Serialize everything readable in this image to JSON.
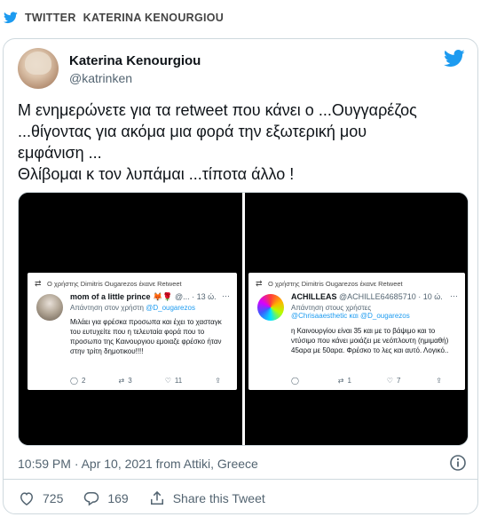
{
  "source": {
    "platform": "TWITTER",
    "author": "KATERINA KENOURGIOU"
  },
  "tweet": {
    "name": "Katerina Kenourgiou",
    "handle": "@katrinken",
    "text_lines": [
      "Μ ενημερώνετε για τα retweet που κάνει ο ...Ουγγαρέζος",
      "...θίγοντας για ακόμα μια φορά την εξωτερική μου",
      "εμφάνιση ...",
      "Θλίβομαι κ τον λυπάμαι ...τίποτα άλλο !"
    ],
    "timestamp": "10:59 PM · Apr 10, 2021 from Attiki, Greece",
    "likes": "725",
    "replies": "169",
    "share_label": "Share this Tweet"
  },
  "media": {
    "left": {
      "retweet_line": "Ο χρήστης Dimitris Ougarezos έκανε Retweet",
      "name": "mom of a little prince",
      "name_emoji": "🦊🌹",
      "meta": "@... · 13 ώ.",
      "reply_prefix": "Απάντηση στον χρήστη",
      "reply_mentions": "@D_ougarezos",
      "body": "Μιλάει για φρέσκα προσωπα και έχει το χασταγκ του ευτυχείτε που η τελευταία φορά που το προσωπο της Καινουργιου εμοιαζε φρέσκο ήταν στην τρίτη δημοτικου!!!!",
      "reply_count": "2",
      "retweet_count": "3",
      "like_count": "11"
    },
    "right": {
      "retweet_line": "Ο χρήστης Dimitris Ougarezos έκανε Retweet",
      "name": "ACHILLEAS",
      "meta": "@ACHILLE64685710 · 10 ώ.",
      "reply_prefix": "Απάντηση στους χρήστες",
      "reply_mentions": "@Chrisaaesthetic και @D_ougarezos",
      "body": "η Καινουργίου είναι 35 και με το βάψιμο και το ντύσιμο που κάνει μοιάζει με νεόπλουτη (ημιμαθή) 45αρα με 50αρα. Φρέσκο το λες και αυτό. Λογικό..",
      "reply_count": "",
      "retweet_count": "1",
      "like_count": "7"
    }
  },
  "colors": {
    "twitter_blue": "#1d9bf0",
    "secondary_text": "#536471",
    "border": "#cfd9de"
  }
}
